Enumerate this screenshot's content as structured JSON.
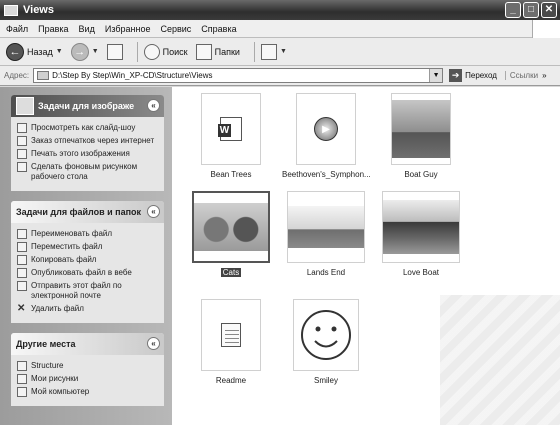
{
  "window": {
    "title": "Views",
    "minimize": "_",
    "maximize": "□",
    "close": "✕"
  },
  "menu": [
    "Файл",
    "Правка",
    "Вид",
    "Избранное",
    "Сервис",
    "Справка"
  ],
  "toolbar": {
    "back": "Назад",
    "search": "Поиск",
    "folders": "Папки"
  },
  "address": {
    "label": "Адрес:",
    "path": "D:\\Step By Step\\Win_XP-CD\\Structure\\Views",
    "go": "Переход",
    "links": "Ссылки"
  },
  "panels": {
    "image_tasks": {
      "title": "Задачи для изображе",
      "items": [
        "Просмотреть как слайд-шоу",
        "Заказ отпечатков через интернет",
        "Печать этого изображения",
        "Сделать фоновым рисунком рабочего стола"
      ]
    },
    "file_tasks": {
      "title": "Задачи для файлов и папок",
      "items": [
        "Переименовать файл",
        "Переместить файл",
        "Копировать файл",
        "Опубликовать файл в вебе",
        "Отправить этот файл по электронной почте",
        "Удалить файл"
      ]
    },
    "other_places": {
      "title": "Другие места",
      "items": [
        "Structure",
        "Мои рисунки",
        "Мой компьютер"
      ]
    }
  },
  "files": [
    {
      "name": "Bean Trees",
      "icon": "word-document-icon"
    },
    {
      "name": "Beethoven's_Symphon...",
      "icon": "media-file-icon"
    },
    {
      "name": "Boat Guy",
      "icon": "photo-thumbnail"
    },
    {
      "name": "Cats",
      "icon": "photo-thumbnail",
      "selected": true
    },
    {
      "name": "Lands End",
      "icon": "photo-thumbnail"
    },
    {
      "name": "Love Boat",
      "icon": "photo-thumbnail"
    },
    {
      "name": "Readme",
      "icon": "text-document-icon"
    },
    {
      "name": "Smiley",
      "icon": "drawing-thumbnail"
    }
  ]
}
